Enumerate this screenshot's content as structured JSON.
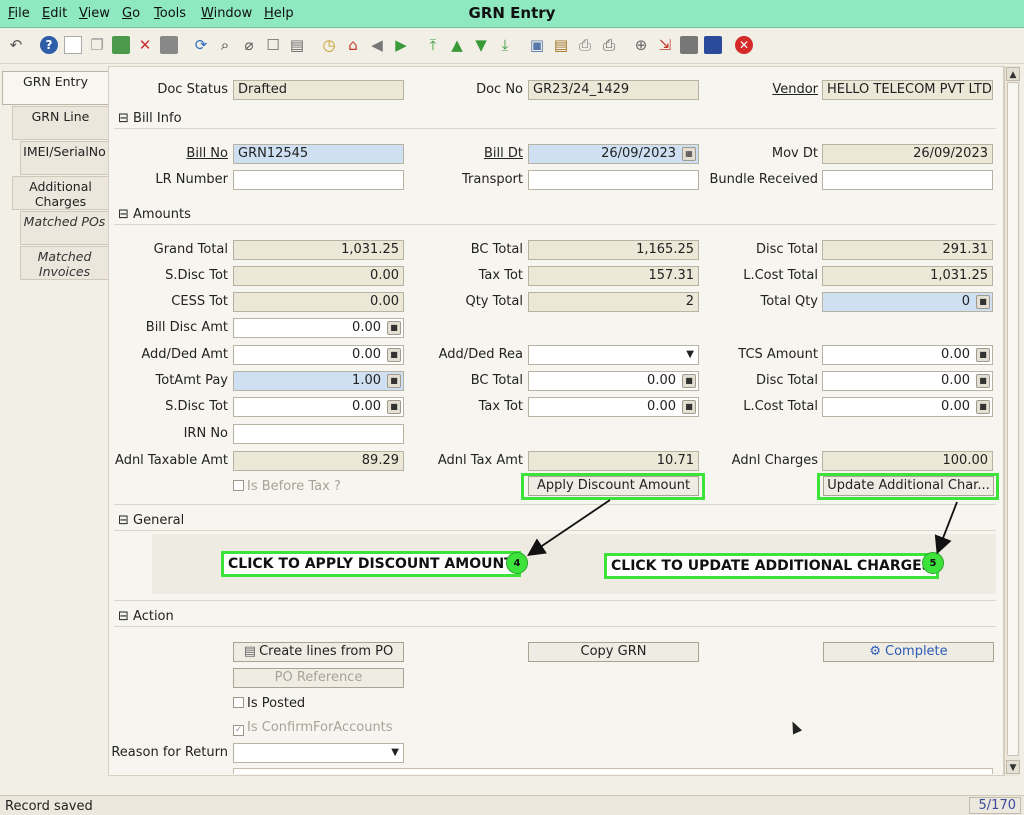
{
  "window": {
    "title": "GRN Entry"
  },
  "menu": [
    "File",
    "Edit",
    "View",
    "Go",
    "Tools",
    "Window",
    "Help"
  ],
  "toolbar_icons": [
    "undo-icon",
    "help-icon",
    "new-icon",
    "copy-icon",
    "delete-icon",
    "close-icon",
    "save-icon",
    "refresh-icon",
    "find-icon",
    "attachment-icon",
    "chat-icon",
    "report-icon",
    "history-icon",
    "home-icon",
    "back-icon",
    "forward-icon",
    "first-icon",
    "previous-icon",
    "next-icon",
    "last-icon",
    "detail-icon",
    "archive-icon",
    "print-preview-icon",
    "print-icon",
    "zoom-icon",
    "workflow-icon",
    "request-icon",
    "product-icon",
    "exit-icon"
  ],
  "tabs": [
    "GRN Entry",
    "GRN Line",
    "IMEI/SerialNo",
    "Additional Charges",
    "Matched POs",
    "Matched Invoices"
  ],
  "header": {
    "doc_status_label": "Doc Status",
    "doc_status": "Drafted",
    "doc_no_label": "Doc No",
    "doc_no": "GR23/24_1429",
    "vendor_label": "Vendor",
    "vendor": "HELLO TELECOM PVT LTD"
  },
  "bill_info": {
    "title": "Bill Info",
    "bill_no_label": "Bill No",
    "bill_no": "GRN12545",
    "bill_dt_label": "Bill Dt",
    "bill_dt": "26/09/2023",
    "mov_dt_label": "Mov Dt",
    "mov_dt": "26/09/2023",
    "lr_number_label": "LR Number",
    "lr_number": "",
    "transport_label": "Transport",
    "transport": "",
    "bundle_received_label": "Bundle Received",
    "bundle_received": ""
  },
  "amounts": {
    "title": "Amounts",
    "grand_total_label": "Grand Total",
    "grand_total": "1,031.25",
    "bc_total_label": "BC Total",
    "bc_total": "1,165.25",
    "disc_total_label": "Disc Total",
    "disc_total": "291.31",
    "sdisc_tot_label": "S.Disc Tot",
    "sdisc_tot": "0.00",
    "tax_tot_label": "Tax Tot",
    "tax_tot": "157.31",
    "lcost_total_label": "L.Cost Total",
    "lcost_total": "1,031.25",
    "cess_tot_label": "CESS Tot",
    "cess_tot": "0.00",
    "qty_total_label": "Qty Total",
    "qty_total": "2",
    "total_qty_label": "Total Qty",
    "total_qty": "0",
    "bill_disc_amt_label": "Bill Disc Amt",
    "bill_disc_amt": "0.00",
    "add_ded_amt_label": "Add/Ded Amt",
    "add_ded_amt": "0.00",
    "add_ded_rea_label": "Add/Ded Rea",
    "add_ded_rea": "",
    "tcs_amount_label": "TCS Amount",
    "tcs_amount": "0.00",
    "totamt_pay_label": "TotAmt Pay",
    "totamt_pay": "1.00",
    "bc_total2_label": "BC Total",
    "bc_total2": "0.00",
    "disc_total2_label": "Disc Total",
    "disc_total2": "0.00",
    "sdisc_tot2_label": "S.Disc Tot",
    "sdisc_tot2": "0.00",
    "tax_tot2_label": "Tax Tot",
    "tax_tot2": "0.00",
    "lcost_total2_label": "L.Cost Total",
    "lcost_total2": "0.00",
    "irn_no_label": "IRN No",
    "irn_no": "",
    "adnl_taxable_amt_label": "Adnl Taxable Amt",
    "adnl_taxable_amt": "89.29",
    "adnl_tax_amt_label": "Adnl Tax Amt",
    "adnl_tax_amt": "10.71",
    "adnl_charges_label": "Adnl Charges",
    "adnl_charges": "100.00",
    "is_before_tax_label": "Is Before Tax ?",
    "apply_discount_button": "Apply Discount Amount",
    "update_additional_button": "Update Additional Char..."
  },
  "general": {
    "title": "General"
  },
  "callouts": {
    "apply_text": "CLICK TO APPLY DISCOUNT AMOUNT",
    "apply_badge": "4",
    "update_text": "CLICK TO UPDATE ADDITIONAL CHARGES",
    "update_badge": "5"
  },
  "action": {
    "title": "Action",
    "create_lines_button": "Create lines from PO",
    "copy_grn_button": "Copy GRN",
    "complete_button": "Complete",
    "po_reference_button": "PO Reference",
    "is_posted_label": "Is Posted",
    "is_confirm_label": "Is ConfirmForAccounts",
    "reason_for_return_label": "Reason for Return",
    "reason_for_return": ""
  },
  "status": {
    "message": "Record saved",
    "record_count": "5/170"
  },
  "colors": {
    "titlebar": "#8ee8c0",
    "highlight": "#3de23a",
    "mandatory_field": "#cfe0f2"
  }
}
